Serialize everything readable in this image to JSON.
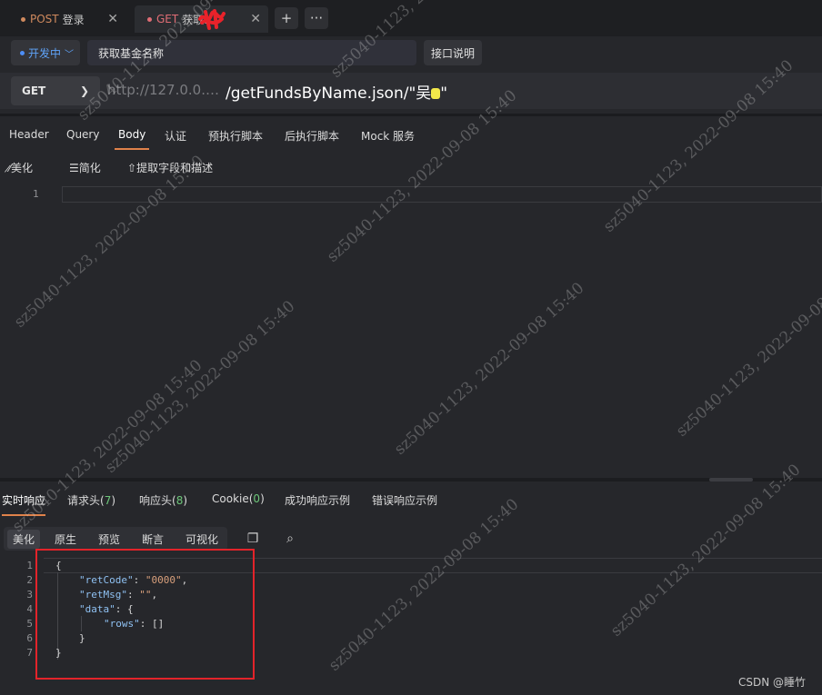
{
  "tabs": [
    {
      "method": "POST",
      "title": "登录",
      "color": "#d08a5e"
    },
    {
      "method": "GET",
      "title": "获取…",
      "color": "#e06d75"
    }
  ],
  "tab_actions": {
    "add": "+",
    "more": "···"
  },
  "env": {
    "label": "开发中"
  },
  "request_name": "获取基金名称",
  "doc_button": "接口说明",
  "method": "GET",
  "url": {
    "host": "http://127.0.0.…",
    "path": "/getFundsByName.json/\"吴",
    "path_end": "\""
  },
  "request_tabs": [
    "Header",
    "Query",
    "Body",
    "认证",
    "预执行脚本",
    "后执行脚本",
    "Mock 服务"
  ],
  "active_request_tab": "Body",
  "body_tools": {
    "beautify": "美化",
    "simplify": "简化",
    "extract": "提取字段和描述"
  },
  "editor_line": "1",
  "response_tabs": {
    "realtime": "实时响应",
    "req_headers": "请求头(",
    "req_headers_count": "7",
    "resp_headers": "响应头(",
    "resp_headers_count": "8",
    "cookie": "Cookie(",
    "cookie_count": "0",
    "close_paren": ")",
    "success_example": "成功响应示例",
    "error_example": "错误响应示例"
  },
  "view_modes": [
    "美化",
    "原生",
    "预览",
    "断言",
    "可视化"
  ],
  "code_lines": [
    "1",
    "2",
    "3",
    "4",
    "5",
    "6",
    "7"
  ],
  "json_response": {
    "l1": "{",
    "ret_code_key": "\"retCode\"",
    "ret_code_val": "\"0000\"",
    "ret_msg_key": "\"retMsg\"",
    "ret_msg_val": "\"\"",
    "data_key": "\"data\"",
    "rows_key": "\"rows\"",
    "rows_val": "[]",
    "colon": ": ",
    "comma": ",",
    "open_brace": "{",
    "close_brace": "}"
  },
  "watermark": "sz5040-1123, 2022-09-08 15:40",
  "credit": "CSDN @睡竹",
  "colors": {
    "accent": "#e0824a",
    "highlight_box": "#e3232a",
    "env": "#5fa3f8"
  }
}
